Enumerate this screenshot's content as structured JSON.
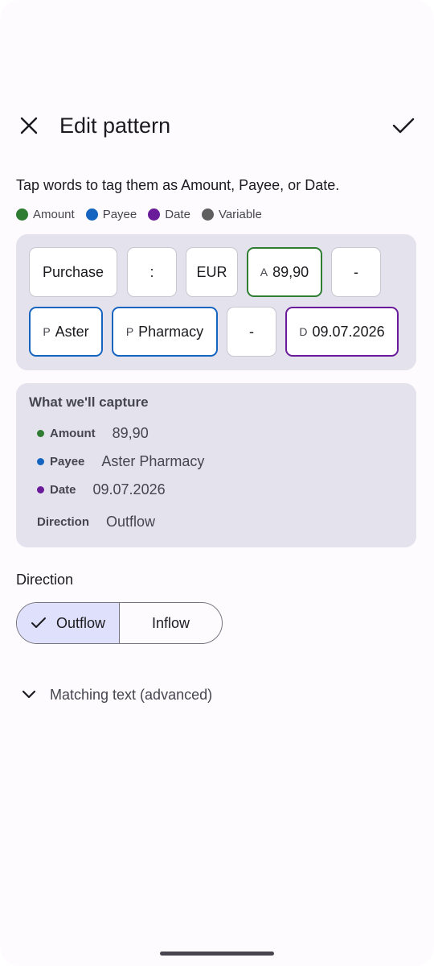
{
  "appbar": {
    "title": "Edit pattern",
    "close_icon": "close-icon",
    "confirm_icon": "check-icon"
  },
  "instructions": "Tap words to tag them as Amount, Payee, or Date.",
  "legend": [
    {
      "label": "Amount",
      "color": "#2e7d32"
    },
    {
      "label": "Payee",
      "color": "#1565c0"
    },
    {
      "label": "Date",
      "color": "#6a1b9a"
    },
    {
      "label": "Variable",
      "color": "#5f5f5f"
    }
  ],
  "tokens": [
    {
      "text": "Purchase",
      "tag": "",
      "prefix": ""
    },
    {
      "text": ":",
      "tag": "",
      "prefix": ""
    },
    {
      "text": "EUR",
      "tag": "",
      "prefix": ""
    },
    {
      "text": "89,90",
      "tag": "amount",
      "prefix": "A"
    },
    {
      "text": "-",
      "tag": "",
      "prefix": ""
    },
    {
      "text": "Aster",
      "tag": "payee",
      "prefix": "P"
    },
    {
      "text": "Pharmacy",
      "tag": "payee",
      "prefix": "P"
    },
    {
      "text": "-",
      "tag": "",
      "prefix": ""
    },
    {
      "text": "09.07.2026",
      "tag": "date",
      "prefix": "D"
    }
  ],
  "capture": {
    "title": "What we'll capture",
    "amount": {
      "label": "Amount",
      "value": "89,90",
      "color": "#2e7d32"
    },
    "payee": {
      "label": "Payee",
      "value": "Aster Pharmacy",
      "color": "#1565c0"
    },
    "date": {
      "label": "Date",
      "value": "09.07.2026",
      "color": "#6a1b9a"
    },
    "direction": {
      "label": "Direction",
      "value": "Outflow"
    }
  },
  "direction": {
    "label": "Direction",
    "options": [
      "Outflow",
      "Inflow"
    ],
    "selected": "Outflow"
  },
  "advanced": {
    "label": "Matching text (advanced)",
    "icon": "chevron-down-icon"
  }
}
